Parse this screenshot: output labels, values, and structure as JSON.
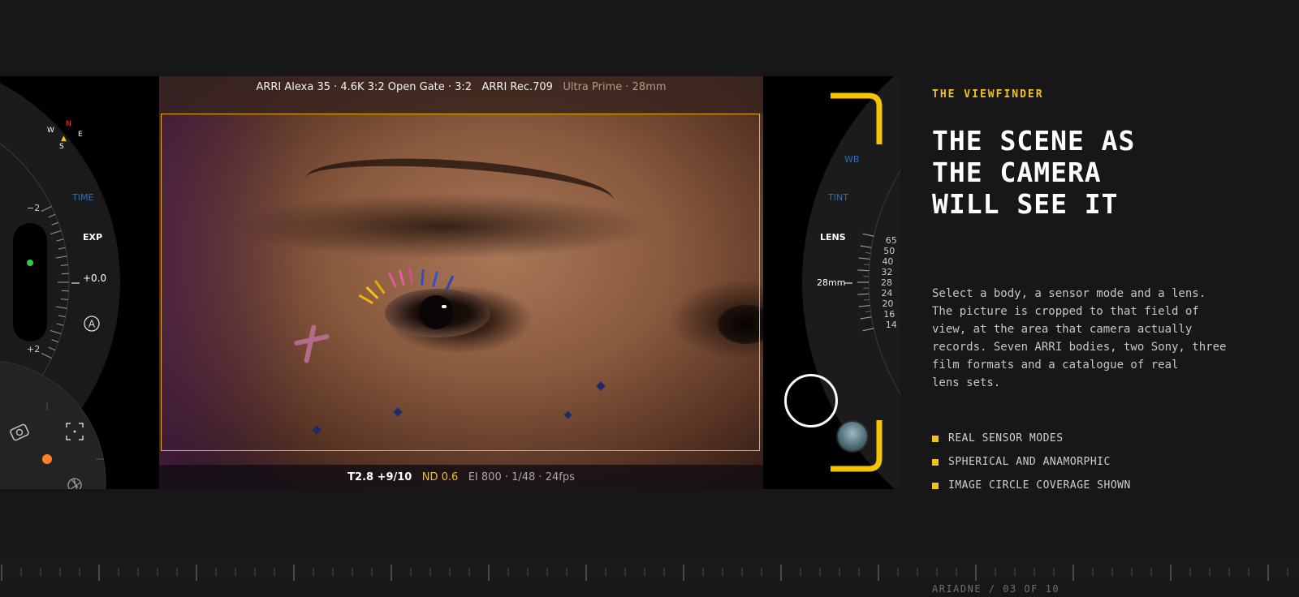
{
  "viewfinder": {
    "status_top": {
      "camera": "ARRI Alexa 35 · 4.6K 3:2 Open Gate · 3:2",
      "color": "ARRI Rec.709",
      "lens": "Ultra Prime · 28mm"
    },
    "status_bottom": {
      "exposure": "T2.8 +9/10",
      "nd": "ND 0.6",
      "rest": "EI 800 · 1/48 · 24fps"
    },
    "left_dial": {
      "compass": {
        "n": "N",
        "w": "W",
        "e": "E",
        "s": "S"
      },
      "time_label": "TIME",
      "exp_label": "EXP",
      "exp_value": "+0.0",
      "scale_min": "−2",
      "scale_max": "+2",
      "auto_label": "A"
    },
    "right_dial": {
      "wb_label": "WB",
      "tint_label": "TINT",
      "lens_label": "LENS",
      "lens_value": "28mm",
      "focal_ticks": [
        "14",
        "16",
        "20",
        "24",
        "28",
        "32",
        "40",
        "50",
        "65"
      ]
    },
    "colors": {
      "accent": "#f2c21b",
      "guide": "#e8b400",
      "blue_label": "#2f6eb0",
      "record_dot": "#2ecc40",
      "orange_dot": "#ff7f2a"
    }
  },
  "info": {
    "eyebrow": "THE VIEWFINDER",
    "headline_lines": [
      "THE SCENE AS",
      "THE CAMERA",
      "WILL SEE IT"
    ],
    "body_lines": [
      "Select a body, a sensor mode and a lens.",
      "The picture is cropped to that field of",
      "view, at the area that camera actually",
      "records. Seven ARRI bodies, two Sony, three",
      "film formats and a catalogue of real",
      "lens sets."
    ],
    "bullets": [
      "REAL SENSOR MODES",
      "SPHERICAL AND ANAMORPHIC",
      "IMAGE CIRCLE COVERAGE SHOWN"
    ]
  },
  "footer": {
    "label": "ARIADNE / 03 OF 10"
  }
}
